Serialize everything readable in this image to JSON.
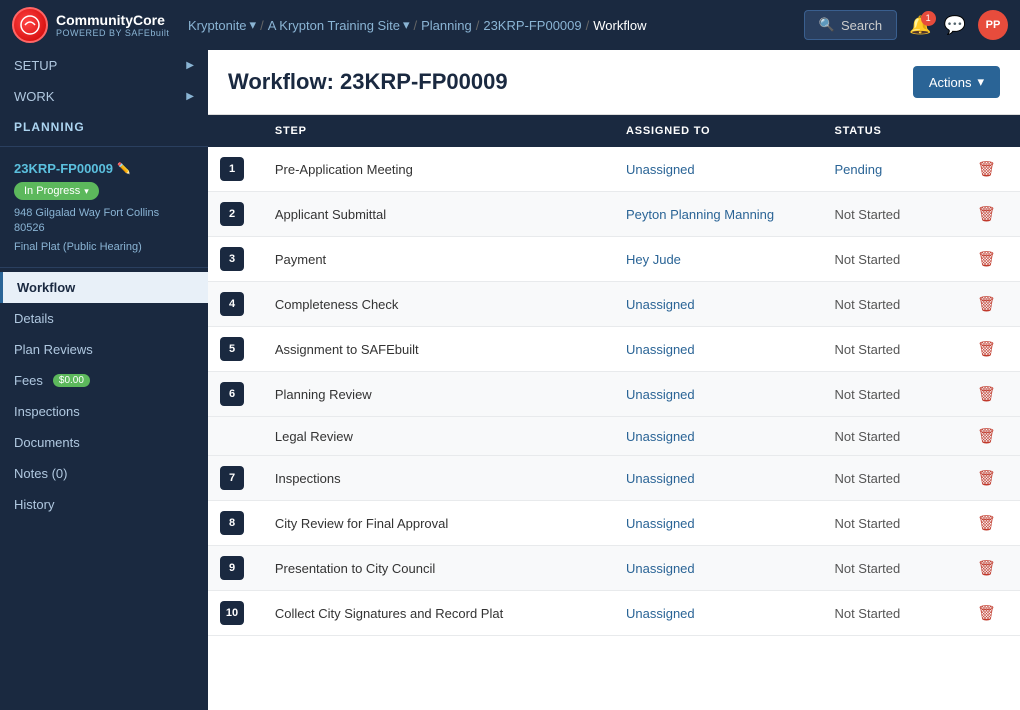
{
  "app": {
    "logo_main": "CommunityCore",
    "logo_sub": "POWERED BY SAFEbuilt",
    "avatar_initials": "PP"
  },
  "breadcrumb": {
    "items": [
      "Kryptonite",
      "A Krypton Training Site",
      "Planning",
      "23KRP-FP00009",
      "Workflow"
    ]
  },
  "search": {
    "label": "Search"
  },
  "notif": {
    "badge": "1"
  },
  "sidebar": {
    "sections": [
      {
        "label": "SETUP",
        "has_arrow": true
      },
      {
        "label": "WORK",
        "has_arrow": true
      },
      {
        "label": "PLANNING",
        "has_arrow": false
      }
    ],
    "record": {
      "id": "23KRP-FP00009",
      "status": "In Progress",
      "address_line1": "948 Gilgalad Way Fort Collins",
      "address_line2": "80526",
      "type": "Final Plat (Public Hearing)"
    },
    "nav_items": [
      {
        "label": "Workflow",
        "active": true
      },
      {
        "label": "Details",
        "active": false
      },
      {
        "label": "Plan Reviews",
        "active": false
      },
      {
        "label": "Fees",
        "active": false,
        "badge": "$0.00"
      },
      {
        "label": "Inspections",
        "active": false
      },
      {
        "label": "Documents",
        "active": false
      },
      {
        "label": "Notes (0)",
        "active": false
      },
      {
        "label": "History",
        "active": false
      }
    ]
  },
  "page": {
    "title": "Workflow: 23KRP-FP00009",
    "actions_label": "Actions"
  },
  "table": {
    "headers": [
      "",
      "STEP",
      "ASSIGNED TO",
      "STATUS",
      ""
    ],
    "rows": [
      {
        "num": "1",
        "step": "Pre-Application Meeting",
        "assigned": "Unassigned",
        "assigned_link": true,
        "status": "Pending",
        "status_link": true
      },
      {
        "num": "2",
        "step": "Applicant Submittal",
        "assigned": "Peyton Planning Manning",
        "assigned_link": true,
        "status": "Not Started",
        "status_link": false
      },
      {
        "num": "3",
        "step": "Payment",
        "assigned": "Hey Jude",
        "assigned_link": true,
        "status": "Not Started",
        "status_link": false
      },
      {
        "num": "4",
        "step": "Completeness Check",
        "assigned": "Unassigned",
        "assigned_link": true,
        "status": "Not Started",
        "status_link": false
      },
      {
        "num": "5",
        "step": "Assignment to SAFEbuilt",
        "assigned": "Unassigned",
        "assigned_link": true,
        "status": "Not Started",
        "status_link": false
      },
      {
        "num": "6",
        "step": "Planning Review",
        "assigned": "Unassigned",
        "assigned_link": true,
        "status": "Not Started",
        "status_link": false,
        "subrows": [
          {
            "step": "Legal Review",
            "assigned": "Unassigned",
            "assigned_link": true,
            "status": "Not Started",
            "status_link": false
          }
        ]
      },
      {
        "num": "7",
        "step": "Inspections",
        "assigned": "Unassigned",
        "assigned_link": true,
        "status": "Not Started",
        "status_link": false
      },
      {
        "num": "8",
        "step": "City Review for Final Approval",
        "assigned": "Unassigned",
        "assigned_link": true,
        "status": "Not Started",
        "status_link": false
      },
      {
        "num": "9",
        "step": "Presentation to City Council",
        "assigned": "Unassigned",
        "assigned_link": true,
        "status": "Not Started",
        "status_link": false
      },
      {
        "num": "10",
        "step": "Collect City Signatures and Record Plat",
        "assigned": "Unassigned",
        "assigned_link": true,
        "status": "Not Started",
        "status_link": false
      }
    ]
  }
}
